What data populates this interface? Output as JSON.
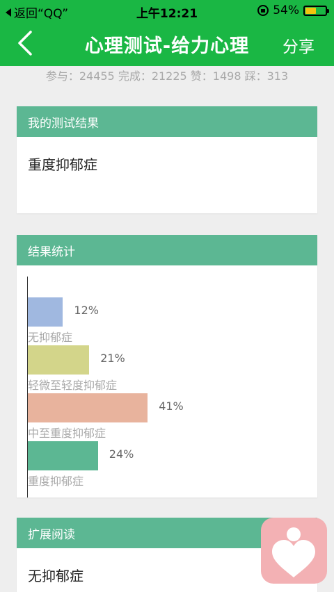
{
  "status_bar": {
    "back_app": "返回“QQ”",
    "time": "上午12:21",
    "battery_text": "54%",
    "battery_level": 0.54
  },
  "nav": {
    "title": "心理测试-给力心理",
    "share_label": "分享"
  },
  "stats_line": "参与：24455 完成：21225 赞：1498 踩：313",
  "result_card": {
    "header": "我的测试结果",
    "result": "重度抑郁症"
  },
  "stats_card": {
    "header": "结果统计"
  },
  "chart_data": {
    "type": "bar",
    "orientation": "horizontal",
    "categories": [
      "无抑郁症",
      "轻微至轻度抑郁症",
      "中至重度抑郁症",
      "重度抑郁症"
    ],
    "values": [
      12,
      21,
      41,
      24
    ],
    "value_labels": [
      "12%",
      "21%",
      "41%",
      "24%"
    ],
    "colors": [
      "#a0b8e0",
      "#d3d58a",
      "#e8b39d",
      "#5cb793"
    ],
    "unit": "%",
    "xlim": [
      0,
      100
    ]
  },
  "extended_card": {
    "header": "扩展阅读",
    "item": "无抑郁症"
  },
  "colors": {
    "brand_green": "#1ab744",
    "card_header": "#5cb793",
    "background": "#eeeeee",
    "logo_bg": "#f3b1b4"
  }
}
